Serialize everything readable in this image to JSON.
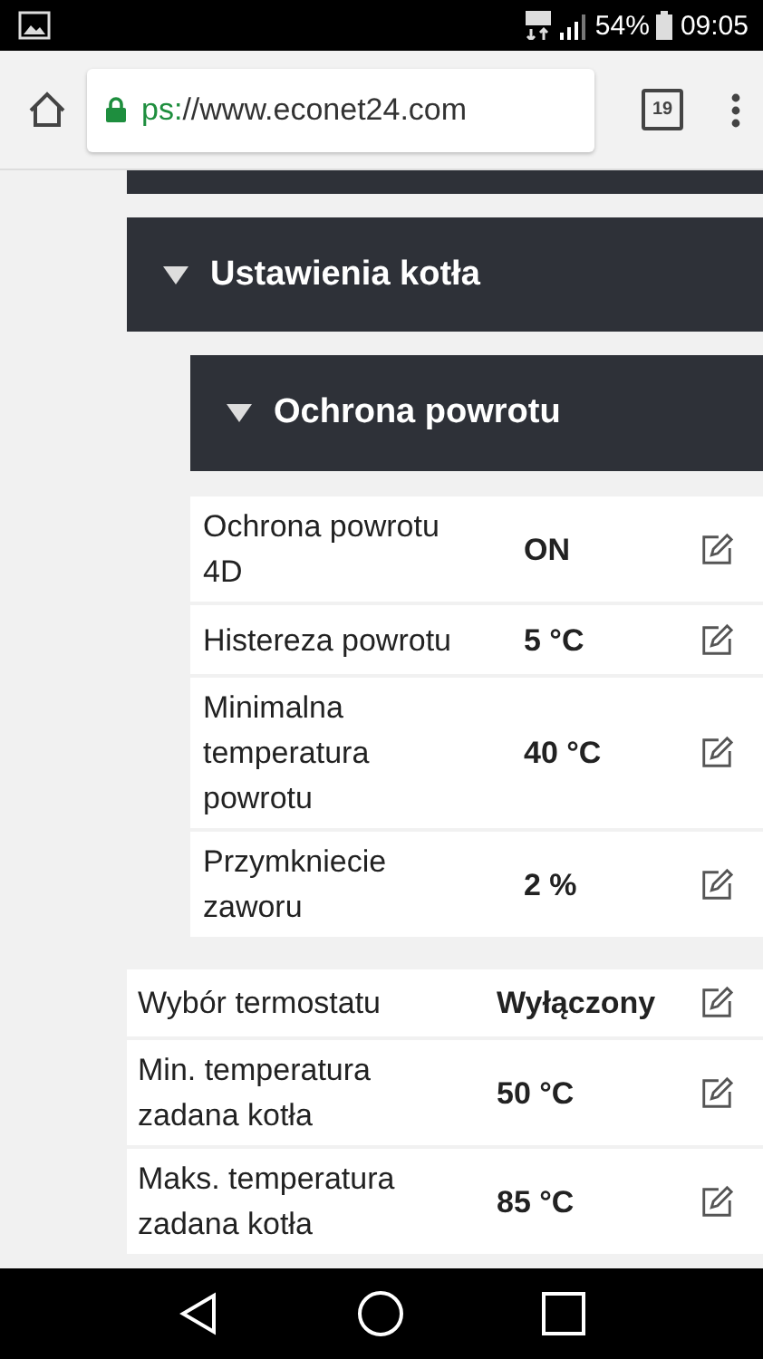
{
  "status_bar": {
    "battery_text": "54%",
    "time": "09:05"
  },
  "browser": {
    "url_scheme": "ps:",
    "url_rest": "//www.econet24.com",
    "tab_count": "19"
  },
  "section": {
    "title": "Ustawienia kotła",
    "expanded": true,
    "subsection": {
      "title": "Ochrona powrotu",
      "expanded": true,
      "rows": [
        {
          "label": "Ochrona powrotu 4D",
          "value": "ON"
        },
        {
          "label": "Histereza powrotu",
          "value": "5 °C"
        },
        {
          "label": "Minimalna temperatura powrotu",
          "value": "40 °C"
        },
        {
          "label": "Przymkniecie zaworu",
          "value": "2 %"
        }
      ]
    },
    "rows": [
      {
        "label": "Wybór termostatu",
        "value": "Wyłączony"
      },
      {
        "label": "Min. temperatura zadana kotła",
        "value": "50 °C"
      },
      {
        "label": "Maks. temperatura zadana kotła",
        "value": "85 °C"
      }
    ]
  }
}
